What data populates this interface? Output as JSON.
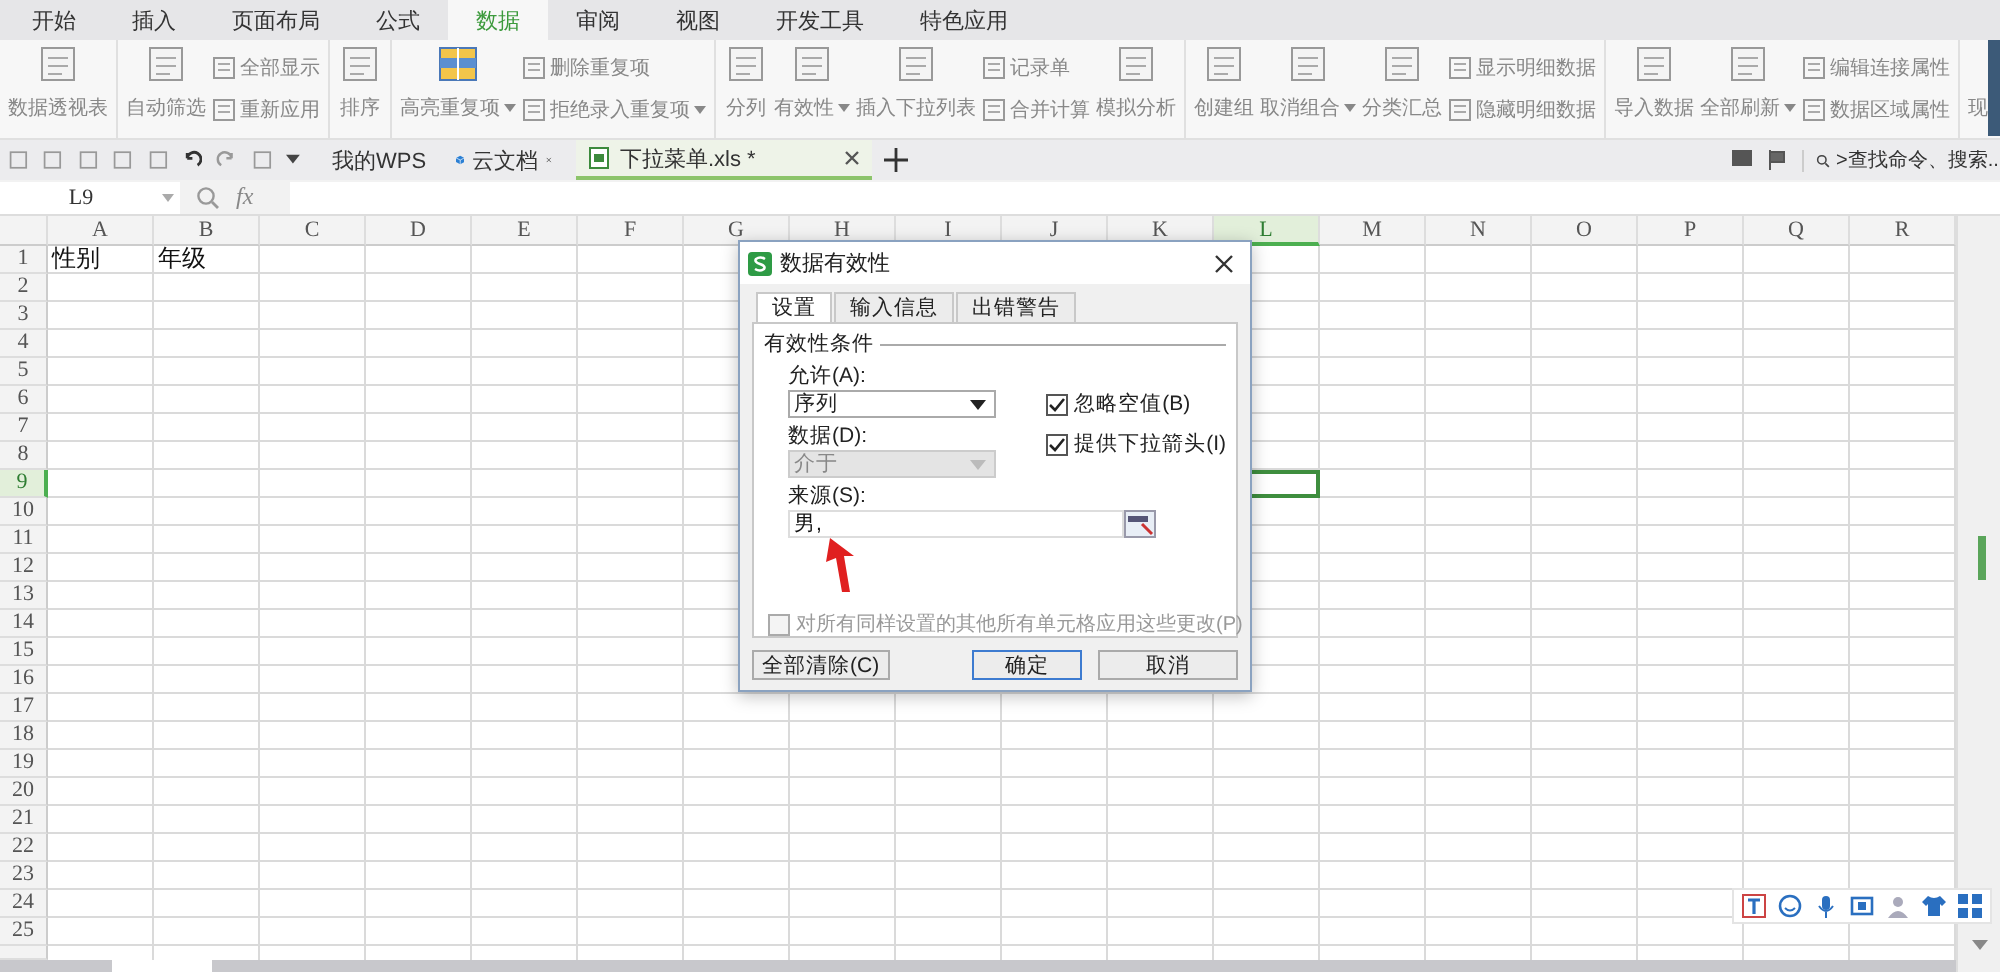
{
  "menu_tabs": [
    {
      "label": "开始",
      "selected": false
    },
    {
      "label": "插入",
      "selected": false
    },
    {
      "label": "页面布局",
      "selected": false
    },
    {
      "label": "公式",
      "selected": false
    },
    {
      "label": "数据",
      "selected": true
    },
    {
      "label": "审阅",
      "selected": false
    },
    {
      "label": "视图",
      "selected": false
    },
    {
      "label": "开发工具",
      "selected": false
    },
    {
      "label": "特色应用",
      "selected": false
    }
  ],
  "ribbon": {
    "groups": [
      {
        "items": [
          {
            "kind": "large",
            "label": "数据透视表",
            "dropdown": false
          }
        ]
      },
      {
        "items": [
          {
            "kind": "large",
            "label": "自动筛选",
            "dropdown": false
          },
          {
            "kind": "stack",
            "items": [
              {
                "label": "全部显示",
                "dropdown": false
              },
              {
                "label": "重新应用",
                "dropdown": false
              }
            ]
          }
        ]
      },
      {
        "items": [
          {
            "kind": "large",
            "label": "排序",
            "dropdown": false
          }
        ]
      },
      {
        "items": [
          {
            "kind": "large",
            "label": "高亮重复项",
            "dropdown": true
          },
          {
            "kind": "stack",
            "items": [
              {
                "label": "删除重复项",
                "dropdown": false
              },
              {
                "label": "拒绝录入重复项",
                "dropdown": true
              }
            ]
          }
        ]
      },
      {
        "items": [
          {
            "kind": "large",
            "label": "分列",
            "dropdown": false
          },
          {
            "kind": "large",
            "label": "有效性",
            "dropdown": true
          },
          {
            "kind": "large",
            "label": "插入下拉列表",
            "dropdown": false
          },
          {
            "kind": "stack",
            "items": [
              {
                "label": "记录单",
                "dropdown": false
              },
              {
                "label": "合并计算",
                "dropdown": false
              }
            ]
          },
          {
            "kind": "large",
            "label": "模拟分析",
            "dropdown": false
          }
        ]
      },
      {
        "items": [
          {
            "kind": "large",
            "label": "创建组",
            "dropdown": false
          },
          {
            "kind": "large",
            "label": "取消组合",
            "dropdown": true
          },
          {
            "kind": "large",
            "label": "分类汇总",
            "dropdown": false
          },
          {
            "kind": "stack",
            "items": [
              {
                "label": "显示明细数据",
                "dropdown": false
              },
              {
                "label": "隐藏明细数据",
                "dropdown": false
              }
            ]
          }
        ]
      },
      {
        "items": [
          {
            "kind": "large",
            "label": "导入数据",
            "dropdown": false
          },
          {
            "kind": "large",
            "label": "全部刷新",
            "dropdown": true
          },
          {
            "kind": "stack",
            "items": [
              {
                "label": "编辑连接属性",
                "dropdown": false
              },
              {
                "label": "数据区域属性",
                "dropdown": false
              }
            ]
          }
        ]
      },
      {
        "items": [
          {
            "kind": "large",
            "label": "现",
            "dropdown": false
          }
        ]
      }
    ]
  },
  "doc_tabs": [
    {
      "label": "我的WPS",
      "selected": false
    },
    {
      "label": "云文档",
      "selected": false
    },
    {
      "label": "下拉菜单.xls *",
      "selected": true
    }
  ],
  "search": {
    "placeholder": ">查找命令、搜索..."
  },
  "formula_bar": {
    "cell_ref": "L9",
    "fx": "fx"
  },
  "sheet": {
    "columns": [
      {
        "label": "A",
        "selected": false
      },
      {
        "label": "B",
        "selected": false
      },
      {
        "label": "C",
        "selected": false
      },
      {
        "label": "D",
        "selected": false
      },
      {
        "label": "E",
        "selected": false
      },
      {
        "label": "F",
        "selected": false
      },
      {
        "label": "G",
        "selected": false
      },
      {
        "label": "H",
        "selected": false
      },
      {
        "label": "I",
        "selected": false
      },
      {
        "label": "J",
        "selected": false
      },
      {
        "label": "K",
        "selected": false
      },
      {
        "label": "L",
        "selected": true
      },
      {
        "label": "M",
        "selected": false
      },
      {
        "label": "N",
        "selected": false
      },
      {
        "label": "O",
        "selected": false
      },
      {
        "label": "P",
        "selected": false
      },
      {
        "label": "Q",
        "selected": false
      },
      {
        "label": "R",
        "selected": false
      }
    ],
    "rows": [
      {
        "label": "1",
        "selected": false,
        "values": [
          "性别",
          "年级"
        ]
      },
      {
        "label": "2",
        "selected": false
      },
      {
        "label": "3",
        "selected": false
      },
      {
        "label": "4",
        "selected": false
      },
      {
        "label": "5",
        "selected": false
      },
      {
        "label": "6",
        "selected": false
      },
      {
        "label": "7",
        "selected": false
      },
      {
        "label": "8",
        "selected": false
      },
      {
        "label": "9",
        "selected": true
      },
      {
        "label": "10",
        "selected": false
      },
      {
        "label": "11",
        "selected": false
      },
      {
        "label": "12",
        "selected": false
      },
      {
        "label": "13",
        "selected": false
      },
      {
        "label": "14",
        "selected": false
      },
      {
        "label": "15",
        "selected": false
      },
      {
        "label": "16",
        "selected": false
      },
      {
        "label": "17",
        "selected": false
      },
      {
        "label": "18",
        "selected": false
      },
      {
        "label": "19",
        "selected": false
      },
      {
        "label": "20",
        "selected": false
      },
      {
        "label": "21",
        "selected": false
      },
      {
        "label": "22",
        "selected": false
      },
      {
        "label": "23",
        "selected": false
      },
      {
        "label": "24",
        "selected": false
      },
      {
        "label": "25",
        "selected": false
      }
    ]
  },
  "dialog": {
    "title": "数据有效性",
    "tabs": [
      {
        "label": "设置",
        "selected": true
      },
      {
        "label": "输入信息",
        "selected": false
      },
      {
        "label": "出错警告",
        "selected": false
      }
    ],
    "section": "有效性条件",
    "allow": {
      "label": "允许(A):",
      "value": "序列",
      "disabled": false
    },
    "data": {
      "label": "数据(D):",
      "value": "介于",
      "disabled": true
    },
    "options": [
      {
        "label": "忽略空值(B)",
        "checked": true
      },
      {
        "label": "提供下拉箭头(I)",
        "checked": true
      }
    ],
    "source": {
      "label": "来源(S):",
      "value": "男,"
    },
    "apply_all": {
      "label": "对所有同样设置的其他所有单元格应用这些更改(P)",
      "checked": false,
      "disabled": true
    },
    "buttons": [
      {
        "label": "全部清除(C)",
        "default": false
      },
      {
        "label": "确定",
        "default": true
      },
      {
        "label": "取消",
        "default": false
      }
    ]
  }
}
